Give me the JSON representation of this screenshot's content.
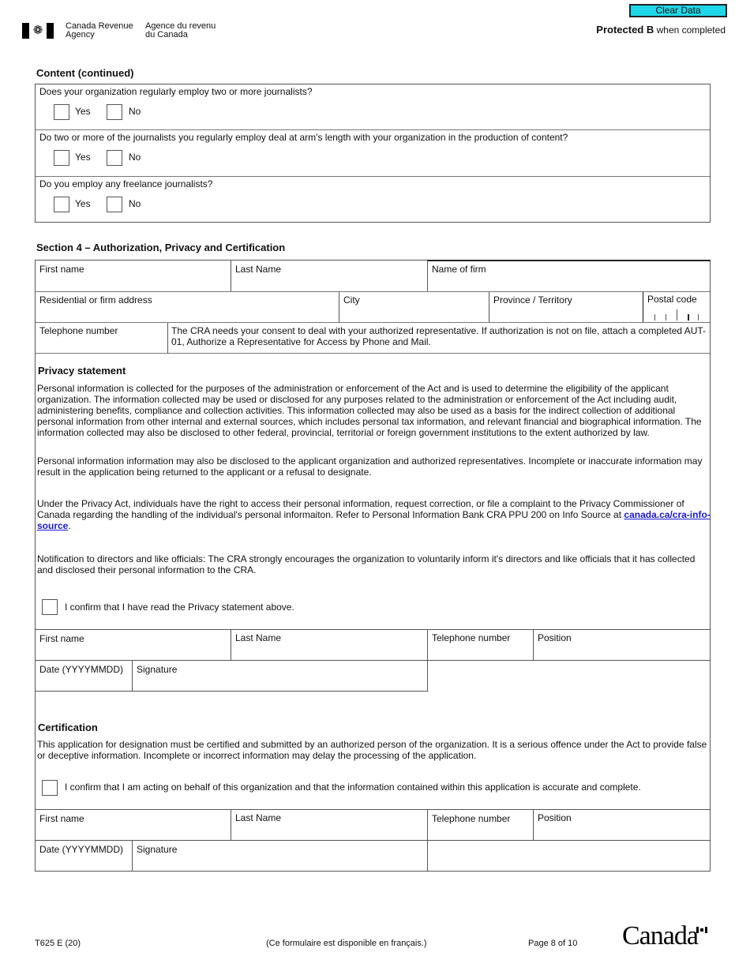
{
  "header": {
    "agency_en_line1": "Canada Revenue",
    "agency_en_line2": "Agency",
    "agency_fr_line1": "Agence du revenu",
    "agency_fr_line2": "du Canada",
    "clear_button": "Clear Data",
    "protected_bold": "Protected B",
    "protected_rest": " when completed",
    "flag_icon": "canada-flag-icon"
  },
  "content": {
    "title": "Content (continued)",
    "questions": [
      {
        "text": "Does your organization regularly employ two or more journalists?",
        "yes": "Yes",
        "no": "No"
      },
      {
        "text": "Do two or more of the journalists you regularly employ deal at arm's length with your organization in the production of content?",
        "yes": "Yes",
        "no": "No"
      },
      {
        "text": "Do you employ any freelance journalists?",
        "yes": "Yes",
        "no": "No"
      }
    ]
  },
  "section4": {
    "title": "Section 4 – Authorization, Privacy and Certification",
    "rep": {
      "first_name": "First name",
      "last_name": "Last Name",
      "firm": "Name of firm",
      "address": "Residential or firm address",
      "city": "City",
      "province": "Province / Territory",
      "postal": "Postal code",
      "telephone": "Telephone number",
      "consent": "The CRA needs your consent to deal with your authorized representative. If authorization is not on file, attach a completed AUT-01, Authorize a Representative for Access by Phone and Mail."
    },
    "privacy": {
      "title": "Privacy statement",
      "p1": "Personal information is collected for the purposes of the administration or enforcement of the Act and is used to determine the eligibility of the applicant organization. The information collected may be used or disclosed for any purposes related to the administration or enforcement of the Act including audit, administering benefits, compliance and collection activities. This information collected may also be used as a basis for the indirect collection of additional personal information from other internal and external sources, which includes personal tax information, and relevant financial and biographical information. The information collected may also be disclosed to other federal, provincial, territorial or foreign government institutions to the extent authorized by law.",
      "p2": "Personal information information may also be disclosed to the applicant organization and authorized representatives. Incomplete or inaccurate information may result in the application being returned to the applicant or a refusal to designate.",
      "p3_before": "Under the Privacy Act, individuals have the right to access their personal information, request correction, or file a complaint to the Privacy Commissioner of Canada regarding the handling of the individual's personal informaiton. Refer to Personal Information Bank CRA PPU 200 on Info Source at ",
      "p3_link": "canada.ca/cra-info-source",
      "p3_after": ".",
      "p4": "Notification to directors and like officials: The CRA strongly encourages the organization to voluntarily inform it's directors and like officials that it has collected and disclosed their personal information to the CRA.",
      "confirm": "I confirm that I have read the Privacy statement above.",
      "fields": {
        "first_name": "First name",
        "last_name": "Last Name",
        "telephone": "Telephone number",
        "position": "Position",
        "date": "Date (YYYYMMDD)",
        "signature": "Signature"
      }
    },
    "certification": {
      "title": "Certification",
      "text": "This application for designation must be certified and submitted by an authorized person of the organization. It is a serious offence under the Act to provide false or deceptive information. Incomplete or incorrect information may delay the processing of the application.",
      "confirm": "I confirm that I am acting on behalf of this organization and that the information contained within this application is accurate and complete.",
      "fields": {
        "first_name": "First name",
        "last_name": "Last Name",
        "telephone": "Telephone number",
        "position": "Position",
        "date": "Date (YYYYMMDD)",
        "signature": "Signature"
      }
    }
  },
  "footer": {
    "form_id": "T625 E (20)",
    "french_note": "(Ce formulaire est disponible en français.)",
    "page": "Page 8 of 10",
    "wordmark": "Canada"
  }
}
